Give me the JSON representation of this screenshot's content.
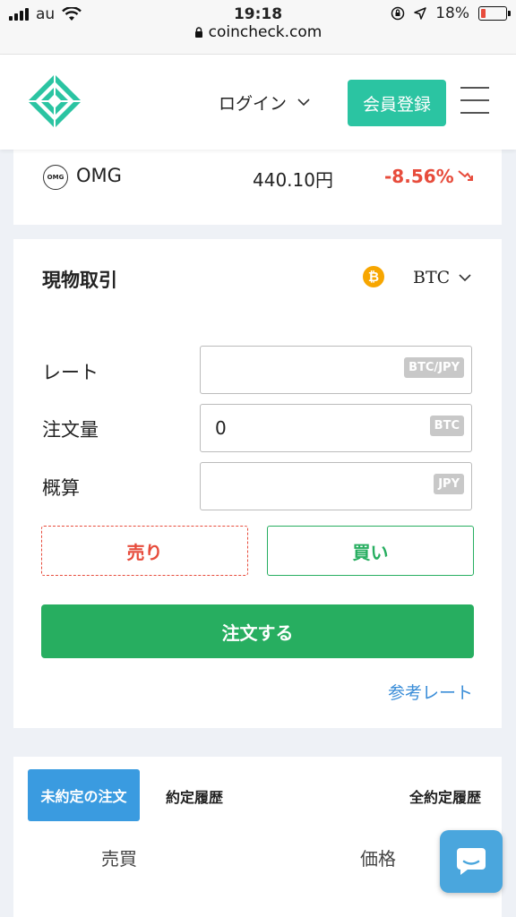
{
  "status_bar": {
    "carrier": "au",
    "time": "19:18",
    "url": "coincheck.com",
    "battery": "18%",
    "battery_level": 0.18
  },
  "header": {
    "login_label": "ログイン",
    "register_label": "会員登録"
  },
  "ticker": {
    "icon_text": "OMG",
    "name": "OMG",
    "price": "440.10円",
    "change": "-8.56%",
    "change_color": "#e74c3c"
  },
  "trade": {
    "title": "現物取引",
    "pair": "BTC",
    "rate_label": "レート",
    "rate_unit": "BTC/JPY",
    "amount_label": "注文量",
    "amount_value": "0",
    "amount_unit": "BTC",
    "estimate_label": "概算",
    "estimate_unit": "JPY",
    "sell_label": "売り",
    "buy_label": "買い",
    "order_label": "注文する",
    "reference_link": "参考レート"
  },
  "history": {
    "tabs": [
      "未約定の注文",
      "約定履歴",
      "全約定履歴"
    ],
    "active_tab": 0,
    "columns": [
      "売買",
      "価格"
    ]
  },
  "colors": {
    "brand": "#2bc4a2",
    "buy": "#27ae60",
    "sell": "#e74c3c",
    "active_tab": "#3a9be0",
    "link": "#3a8dd8"
  }
}
